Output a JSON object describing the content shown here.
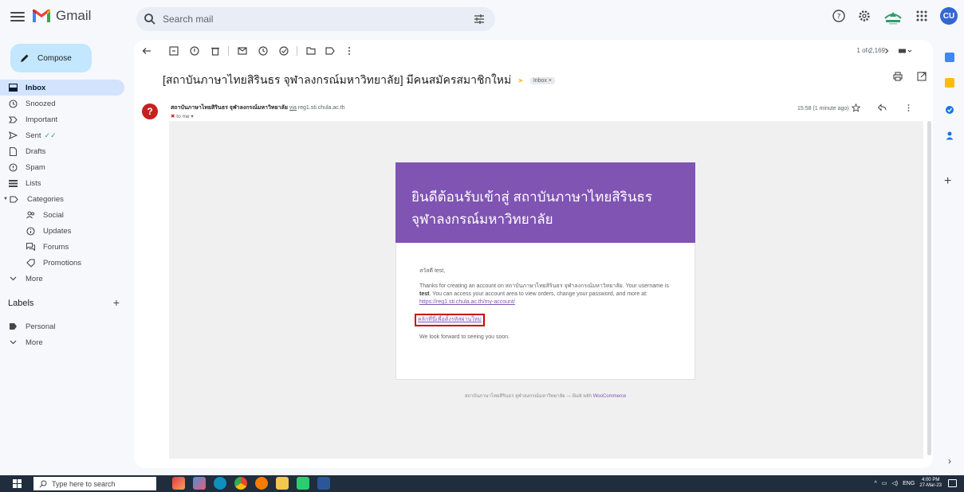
{
  "app": {
    "title": "Gmail"
  },
  "search": {
    "placeholder": "Search mail"
  },
  "account": {
    "initials": "CU"
  },
  "sidebar": {
    "compose_label": "Compose",
    "items": [
      {
        "label": "Inbox",
        "icon": "inbox-icon",
        "active": true
      },
      {
        "label": "Snoozed",
        "icon": "clock-icon"
      },
      {
        "label": "Important",
        "icon": "important-icon"
      },
      {
        "label": "Sent",
        "icon": "send-icon"
      },
      {
        "label": "Drafts",
        "icon": "file-icon"
      },
      {
        "label": "Spam",
        "icon": "spam-icon"
      },
      {
        "label": "Lists",
        "icon": "list-icon"
      },
      {
        "label": "Categories",
        "icon": "label-icon"
      },
      {
        "label": "Social",
        "icon": "people-icon"
      },
      {
        "label": "Updates",
        "icon": "info-icon"
      },
      {
        "label": "Forums",
        "icon": "forum-icon"
      },
      {
        "label": "Promotions",
        "icon": "tag-icon"
      },
      {
        "label": "More",
        "icon": "chevron-down-icon"
      }
    ],
    "labels_title": "Labels",
    "labels_add": "+",
    "labels": [
      {
        "label": "Personal",
        "icon": "label-icon"
      },
      {
        "label": "More",
        "icon": "chevron-down-icon"
      }
    ]
  },
  "toolbar": {
    "pager": "1 of 2,169"
  },
  "email": {
    "subject": "[สถาบันภาษาไทยสิรินธร จุฬาลงกรณ์มหาวิทยาลัย] มีคนสมัครสมาชิกใหม่",
    "inbox_chip": "Inbox ×",
    "sender_initial": "?",
    "sender_name": "สถาบันภาษาไทยสิรินธร จุฬาลงกรณ์มหาวิทยาลัย",
    "sender_via": "via",
    "sender_domain": "reg1.sti.chula.ac.th",
    "to": "to me ▾",
    "time": "15:58 (1 minute ago)",
    "header_title": "ยินดีต้อนรับเข้าสู่ สถาบันภาษาไทยสิรินธร จุฬาลงกรณ์มหาวิทยาลัย",
    "greeting": "สวัสดี test,",
    "para1_a": "Thanks for creating an account on สถาบันภาษาไทยสิรินธร จุฬาลงกรณ์มหาวิทยาลัย. Your username is ",
    "para1_user": "test",
    "para1_b": ". You can access your account area to view orders, change your password, and more at: ",
    "account_link": "https://reg1.sti.chula.ac.th/my-account/",
    "reset_link": "คลิกที่นี่เพื่อตั้งรหัสผ่านใหม่",
    "closing": "We look forward to seeing you soon.",
    "footer_text": "สถาบันภาษาไทยสิรินธร จุฬาลงกรณ์มหาวิทยาลัย — Built with ",
    "footer_link": "WooCommerce"
  },
  "taskbar": {
    "search_placeholder": "Type here to search",
    "lang": "ENG",
    "time": "4:00 PM",
    "date": "27-Mar-23"
  },
  "colors": {
    "header_purple": "#7f54b3",
    "compose_bg": "#c2e7ff",
    "active_nav": "#d3e3fd",
    "highlight_red": "#cc0000"
  }
}
